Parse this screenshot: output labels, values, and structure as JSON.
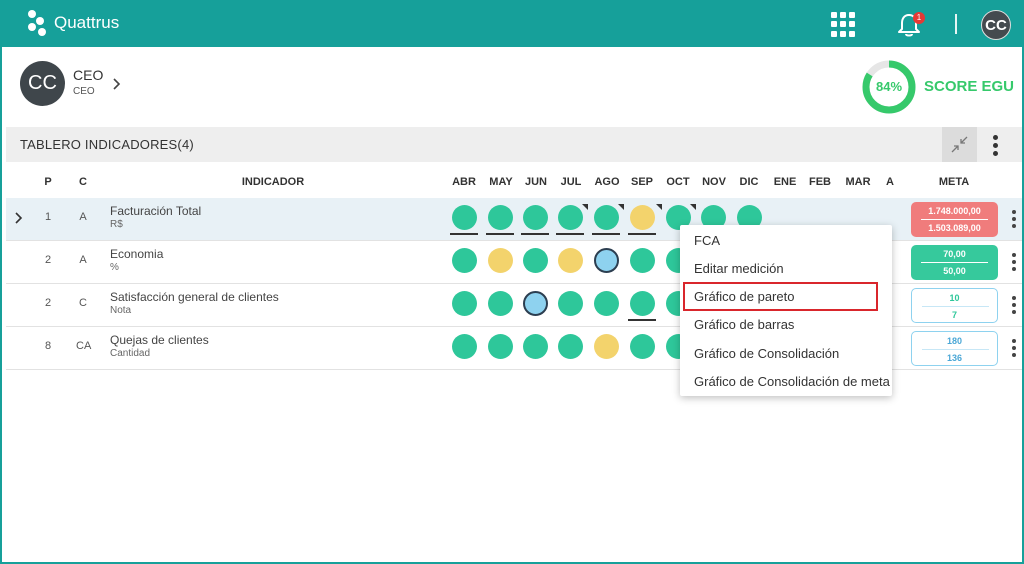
{
  "app": {
    "name": "Quattrus",
    "notification_count": "1",
    "user_initials": "CC"
  },
  "profile": {
    "initials": "CC",
    "name": "CEO",
    "role": "CEO"
  },
  "score": {
    "value": "84%",
    "percent": 84,
    "label": "SCORE EGU",
    "color": "#36c96b"
  },
  "board": {
    "title": "TABLERO INDICADORES(4)"
  },
  "columns": {
    "p": "P",
    "c": "C",
    "indicador": "INDICADOR",
    "meta": "META",
    "months": [
      "ABR",
      "MAY",
      "JUN",
      "JUL",
      "AGO",
      "SEP",
      "OCT",
      "NOV",
      "DIC",
      "ENE",
      "FEB",
      "MAR",
      "A"
    ]
  },
  "rows": [
    {
      "p": "1",
      "c": "A",
      "name": "Facturación Total",
      "unit": "R$",
      "statuses": [
        "green",
        "green",
        "green",
        "green",
        "green",
        "yellow",
        "green",
        "green",
        "green"
      ],
      "meta": [
        "1.748.000,00",
        "1.503.089,00"
      ],
      "meta_style": "red"
    },
    {
      "p": "2",
      "c": "A",
      "name": "Economia",
      "unit": "%",
      "statuses": [
        "green",
        "yellow",
        "green",
        "yellow",
        "blue",
        "green",
        "green"
      ],
      "meta": [
        "70,00",
        "50,00"
      ],
      "meta_style": "green"
    },
    {
      "p": "2",
      "c": "C",
      "name": "Satisfacción general de clientes",
      "unit": "Nota",
      "statuses": [
        "green",
        "green",
        "blue",
        "green",
        "green",
        "green",
        "green"
      ],
      "meta": [
        "10",
        "7"
      ],
      "meta_style": "outline-green"
    },
    {
      "p": "8",
      "c": "CA",
      "name": "Quejas de clientes",
      "unit": "Cantidad",
      "statuses": [
        "green",
        "green",
        "green",
        "green",
        "yellow",
        "green",
        "green"
      ],
      "meta": [
        "180",
        "136"
      ],
      "meta_style": "outline"
    }
  ],
  "context_menu": {
    "items": [
      "FCA",
      "Editar medición",
      "Gráfico de pareto",
      "Gráfico de barras",
      "Gráfico de Consolidación",
      "Gráfico de Consolidación de meta"
    ],
    "highlighted": "Gráfico de pareto"
  },
  "colors": {
    "brand": "#16a09a",
    "green": "#2ec79a",
    "yellow": "#f3d36c",
    "blue": "#8ed2ef",
    "red": "#f07c7c",
    "highlight": "#d9262c"
  },
  "icons": {
    "apps": "apps-grid-icon",
    "bell": "bell-icon",
    "collapse": "collapse-arrows-icon",
    "more": "kebab-icon",
    "expand": "chevron-right-icon"
  }
}
